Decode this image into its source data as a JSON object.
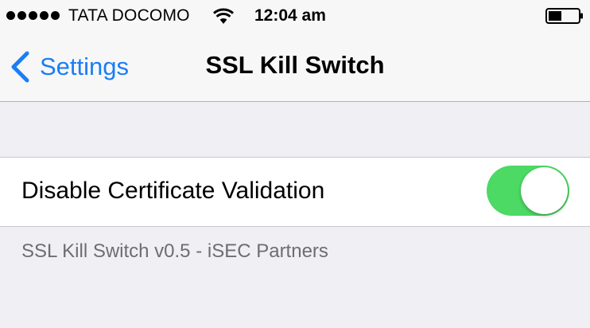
{
  "status_bar": {
    "carrier": "TATA DOCOMO",
    "time": "12:04 am",
    "signal_bars": 5
  },
  "nav": {
    "back_label": "Settings",
    "title": "SSL Kill Switch"
  },
  "settings": {
    "disable_cert_validation": {
      "label": "Disable Certificate Validation",
      "enabled": true
    }
  },
  "footer": {
    "text": "SSL Kill Switch v0.5 - iSEC Partners"
  },
  "colors": {
    "accent": "#1a7ef5",
    "toggle_on": "#4cd964"
  }
}
